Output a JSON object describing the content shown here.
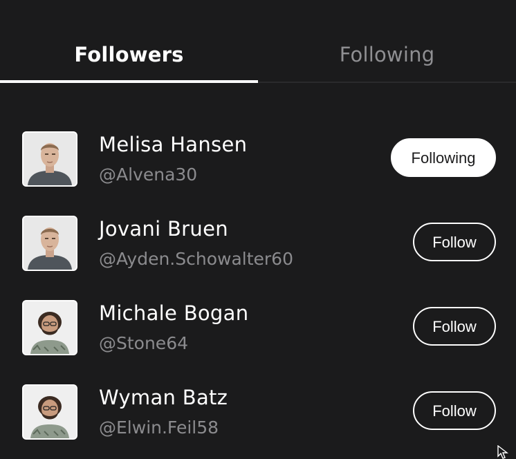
{
  "tabs": {
    "followers": "Followers",
    "following": "Following",
    "active": "followers"
  },
  "users": [
    {
      "name": "Melisa Hansen",
      "handle": "@Alvena30",
      "button": "Following",
      "is_following": true,
      "avatar": "man-portrait-icon"
    },
    {
      "name": "Jovani Bruen",
      "handle": "@Ayden.Schowalter60",
      "button": "Follow",
      "is_following": false,
      "avatar": "man-portrait-icon"
    },
    {
      "name": "Michale Bogan",
      "handle": "@Stone64",
      "button": "Follow",
      "is_following": false,
      "avatar": "bearded-man-portrait-icon"
    },
    {
      "name": "Wyman Batz",
      "handle": "@Elwin.Feil58",
      "button": "Follow",
      "is_following": false,
      "avatar": "bearded-man-portrait-icon"
    }
  ],
  "colors": {
    "background": "#1b1b1c",
    "text_primary": "#ffffff",
    "text_secondary": "#8b8b8e",
    "tab_inactive": "#8f8f92"
  }
}
